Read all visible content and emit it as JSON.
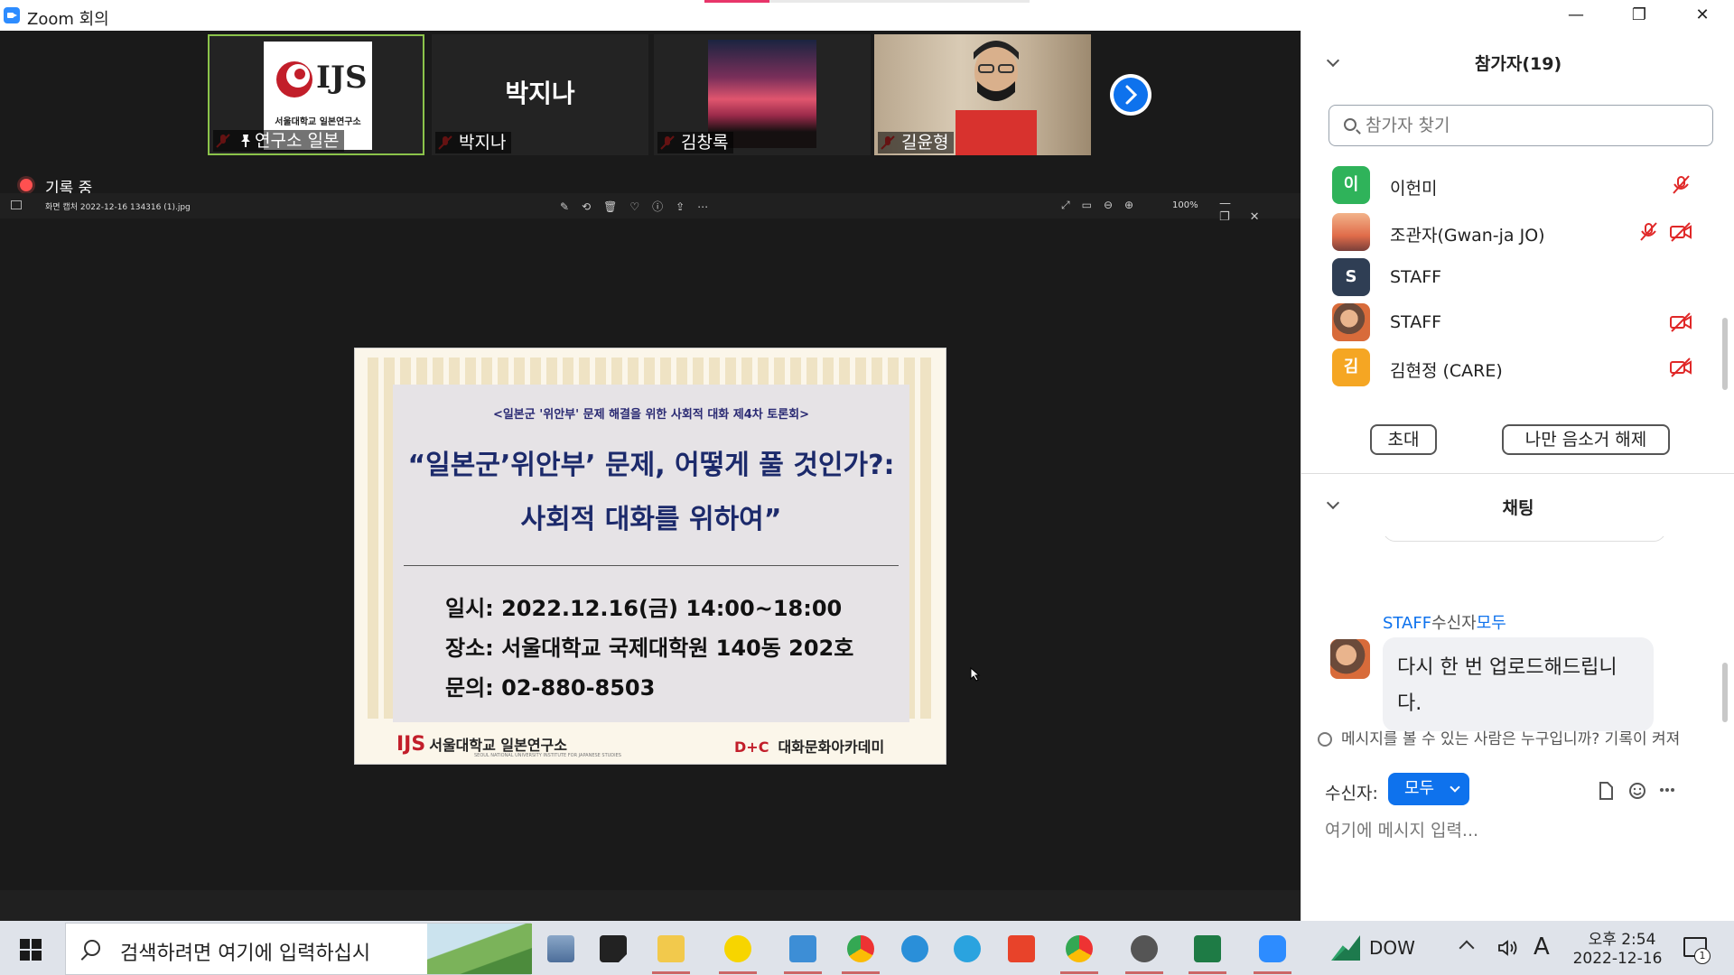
{
  "window": {
    "title": "Zoom 회의",
    "min_glyph": "—",
    "max_glyph": "❐",
    "close_glyph": "✕"
  },
  "gallery": {
    "tiles": [
      {
        "name": "연구소 일본",
        "logo_text": "IJS",
        "logo_sub": "서울대학교 일본연구소"
      },
      {
        "name": "박지나",
        "big_name": "박지나"
      },
      {
        "name": "김창록"
      },
      {
        "name": "길윤형"
      }
    ]
  },
  "recording": {
    "label": "기록 중"
  },
  "viewer": {
    "filename": "화면 캡처 2022-12-16 134316 (1).jpg",
    "zoom": "100%",
    "tool_glyphs": "✎⟲🗑♡ⓘ⇪⋯",
    "right_glyphs": "⤢▭⊖⊕",
    "win_glyphs": "—❐✕"
  },
  "poster": {
    "subtitle": "<일본군 '위안부' 문제 해결을 위한 사회적 대화 제4차 토론회>",
    "headline1": "“일본군’위안부’ 문제, 어떻게 풀 것인가?:",
    "headline2": "사회적 대화를 위하여”",
    "date_line": "일시: 2022.12.16(금) 14:00~18:00",
    "place_line": "장소: 서울대학교 국제대학원 140동 202호",
    "contact_line": "문의: 02-880-8503",
    "footer_left_mark": "IJS",
    "footer_left": "서울대학교 일본연구소",
    "footer_left_sub": "SEOUL NATIONAL UNIVERSITY INSTITUTE FOR JAPANESE STUDIES",
    "footer_right_mark": "D+C",
    "footer_right": "대화문화아카데미"
  },
  "participants": {
    "title": "참가자(19)",
    "search_placeholder": "참가자 찾기",
    "list": [
      {
        "initial": "이",
        "name": "이헌미",
        "color": "#2fb35a"
      },
      {
        "initial": "",
        "name": "조관자(Gwan-ja JO)",
        "color": "#f08a5d"
      },
      {
        "initial": "S",
        "name": "STAFF",
        "color": "#2f3e54"
      },
      {
        "initial": "",
        "name": "STAFF",
        "color": "#8a5a3a"
      },
      {
        "initial": "김",
        "name": "김현정 (CARE)",
        "color": "#f5a623"
      }
    ],
    "invite_label": "초대",
    "unmute_label": "나만 음소거 해제"
  },
  "chat": {
    "title": "채팅",
    "sender": "STAFF",
    "to_word": "수신자",
    "to_target": "모두",
    "message": "다시 한 번 업로드해드립니다.",
    "visibility": "메시지를 볼 수 있는 사람은 누구입니까? 기록이 켜져",
    "recipient_label": "수신자:",
    "recipient_value": "모두",
    "input_placeholder": "여기에 메시지 입력..."
  },
  "taskbar": {
    "search_placeholder": "검색하려면 여기에 입력하십시",
    "tray_app": "DOW",
    "ime": "A",
    "time": "오후 2:54",
    "date": "2022-12-16",
    "notif_count": "1"
  },
  "colors": {
    "zoom_blue": "#0e72ed",
    "mute_red": "#e02828",
    "active_border": "#8bc34a"
  }
}
